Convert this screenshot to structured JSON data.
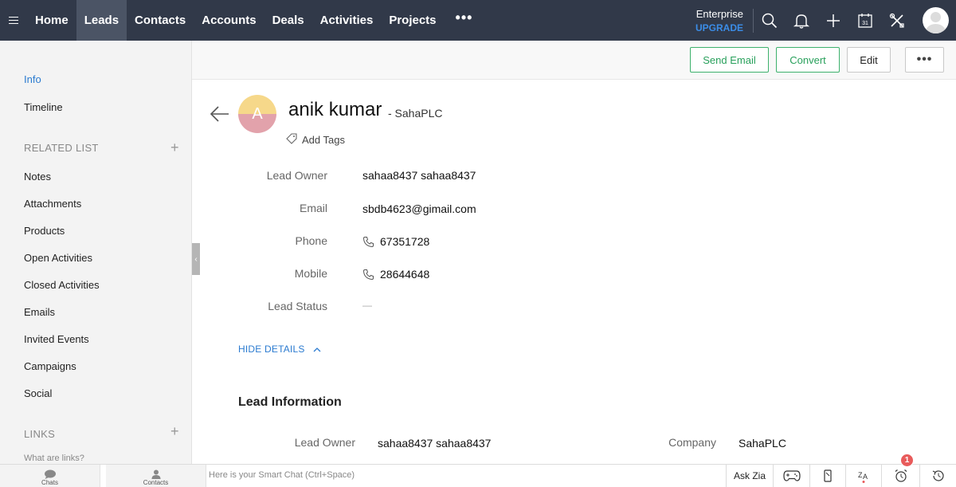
{
  "topnav": {
    "items": [
      {
        "label": "Home",
        "active": false
      },
      {
        "label": "Leads",
        "active": true
      },
      {
        "label": "Contacts",
        "active": false
      },
      {
        "label": "Accounts",
        "active": false
      },
      {
        "label": "Deals",
        "active": false
      },
      {
        "label": "Activities",
        "active": false
      },
      {
        "label": "Projects",
        "active": false
      }
    ],
    "more_label": "•••",
    "edition": "Enterprise",
    "upgrade": "UPGRADE",
    "icons": [
      "search-icon",
      "bell-icon",
      "plus-icon",
      "calendar-icon",
      "setup-tools-icon",
      "user-avatar"
    ],
    "calendar_day": "31",
    "colors": {
      "bar": "#313949",
      "active": "#4b5465",
      "upgrade": "#3b8de8"
    }
  },
  "sidebar": {
    "info": "Info",
    "timeline": "Timeline",
    "related_list_title": "RELATED LIST",
    "related_items": [
      "Notes",
      "Attachments",
      "Products",
      "Open Activities",
      "Closed Activities",
      "Emails",
      "Invited Events",
      "Campaigns",
      "Social"
    ],
    "links_title": "LINKS",
    "links_hint": "What are links?",
    "plus": "+",
    "collapse": "‹"
  },
  "actions": {
    "send_email": "Send Email",
    "convert": "Convert",
    "edit": "Edit",
    "more": "•••"
  },
  "record": {
    "initial": "A",
    "name": "anik kumar",
    "company": "- SahaPLC",
    "add_tags": "Add Tags",
    "fields": [
      {
        "label": "Lead Owner",
        "value": "sahaa8437 sahaa8437",
        "icon": ""
      },
      {
        "label": "Email",
        "value": "sbdb4623@gimail.com",
        "icon": ""
      },
      {
        "label": "Phone",
        "value": "67351728",
        "icon": "phone-icon"
      },
      {
        "label": "Mobile",
        "value": "28644648",
        "icon": "phone-icon"
      },
      {
        "label": "Lead Status",
        "value": "—",
        "icon": ""
      }
    ],
    "hide_details": "HIDE DETAILS"
  },
  "lead_info": {
    "title": "Lead Information",
    "lead_owner_label": "Lead Owner",
    "lead_owner_value": "sahaa8437 sahaa8437",
    "company_label": "Company",
    "company_value": "SahaPLC"
  },
  "bottombar": {
    "chats": "Chats",
    "contacts": "Contacts",
    "smartchat_placeholder": "Here is your Smart Chat (Ctrl+Space)",
    "ask_zia": "Ask Zia",
    "notification_count": "1",
    "icons": [
      "gamepad-icon",
      "mobile-icon",
      "translate-icon",
      "alarm-clock-icon",
      "history-icon"
    ]
  }
}
